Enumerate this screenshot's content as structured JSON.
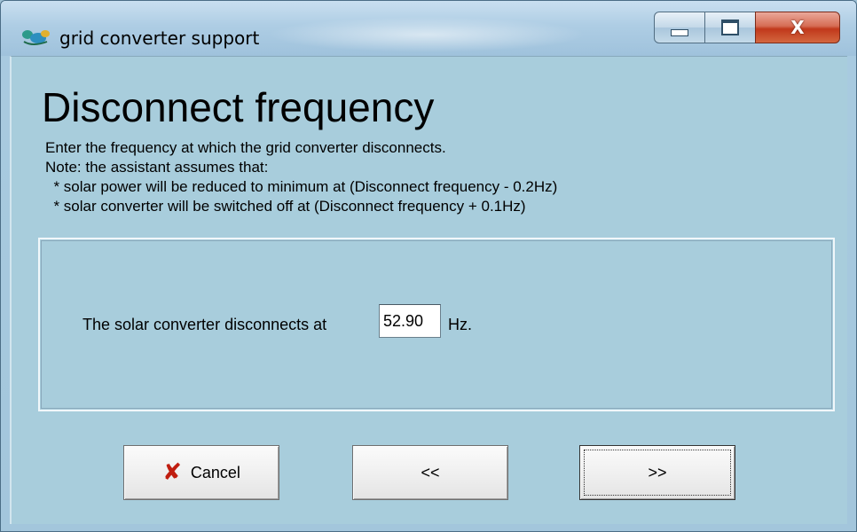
{
  "window": {
    "title": "grid converter support",
    "icon": "app-icon",
    "caption_buttons": {
      "minimize_icon": "minimize-icon",
      "maximize_icon": "maximize-icon",
      "close_glyph": "X"
    }
  },
  "page": {
    "heading": "Disconnect frequency",
    "description": [
      "Enter the frequency at which the grid converter disconnects.",
      "Note: the assistant assumes that:",
      "  * solar power will be reduced to minimum at (Disconnect frequency - 0.2Hz)",
      "  * solar converter will be switched off at (Disconnect frequency + 0.1Hz)"
    ]
  },
  "form": {
    "label": "The solar converter disconnects at",
    "value": "52.90",
    "unit": "Hz."
  },
  "buttons": {
    "cancel_label": "Cancel",
    "cancel_icon": "cancel-x-icon",
    "back_label": "<<",
    "next_label": ">>"
  },
  "colors": {
    "background": "#a8cddc",
    "cancel_icon": "#c01e10",
    "close_button": "#c1381b"
  }
}
